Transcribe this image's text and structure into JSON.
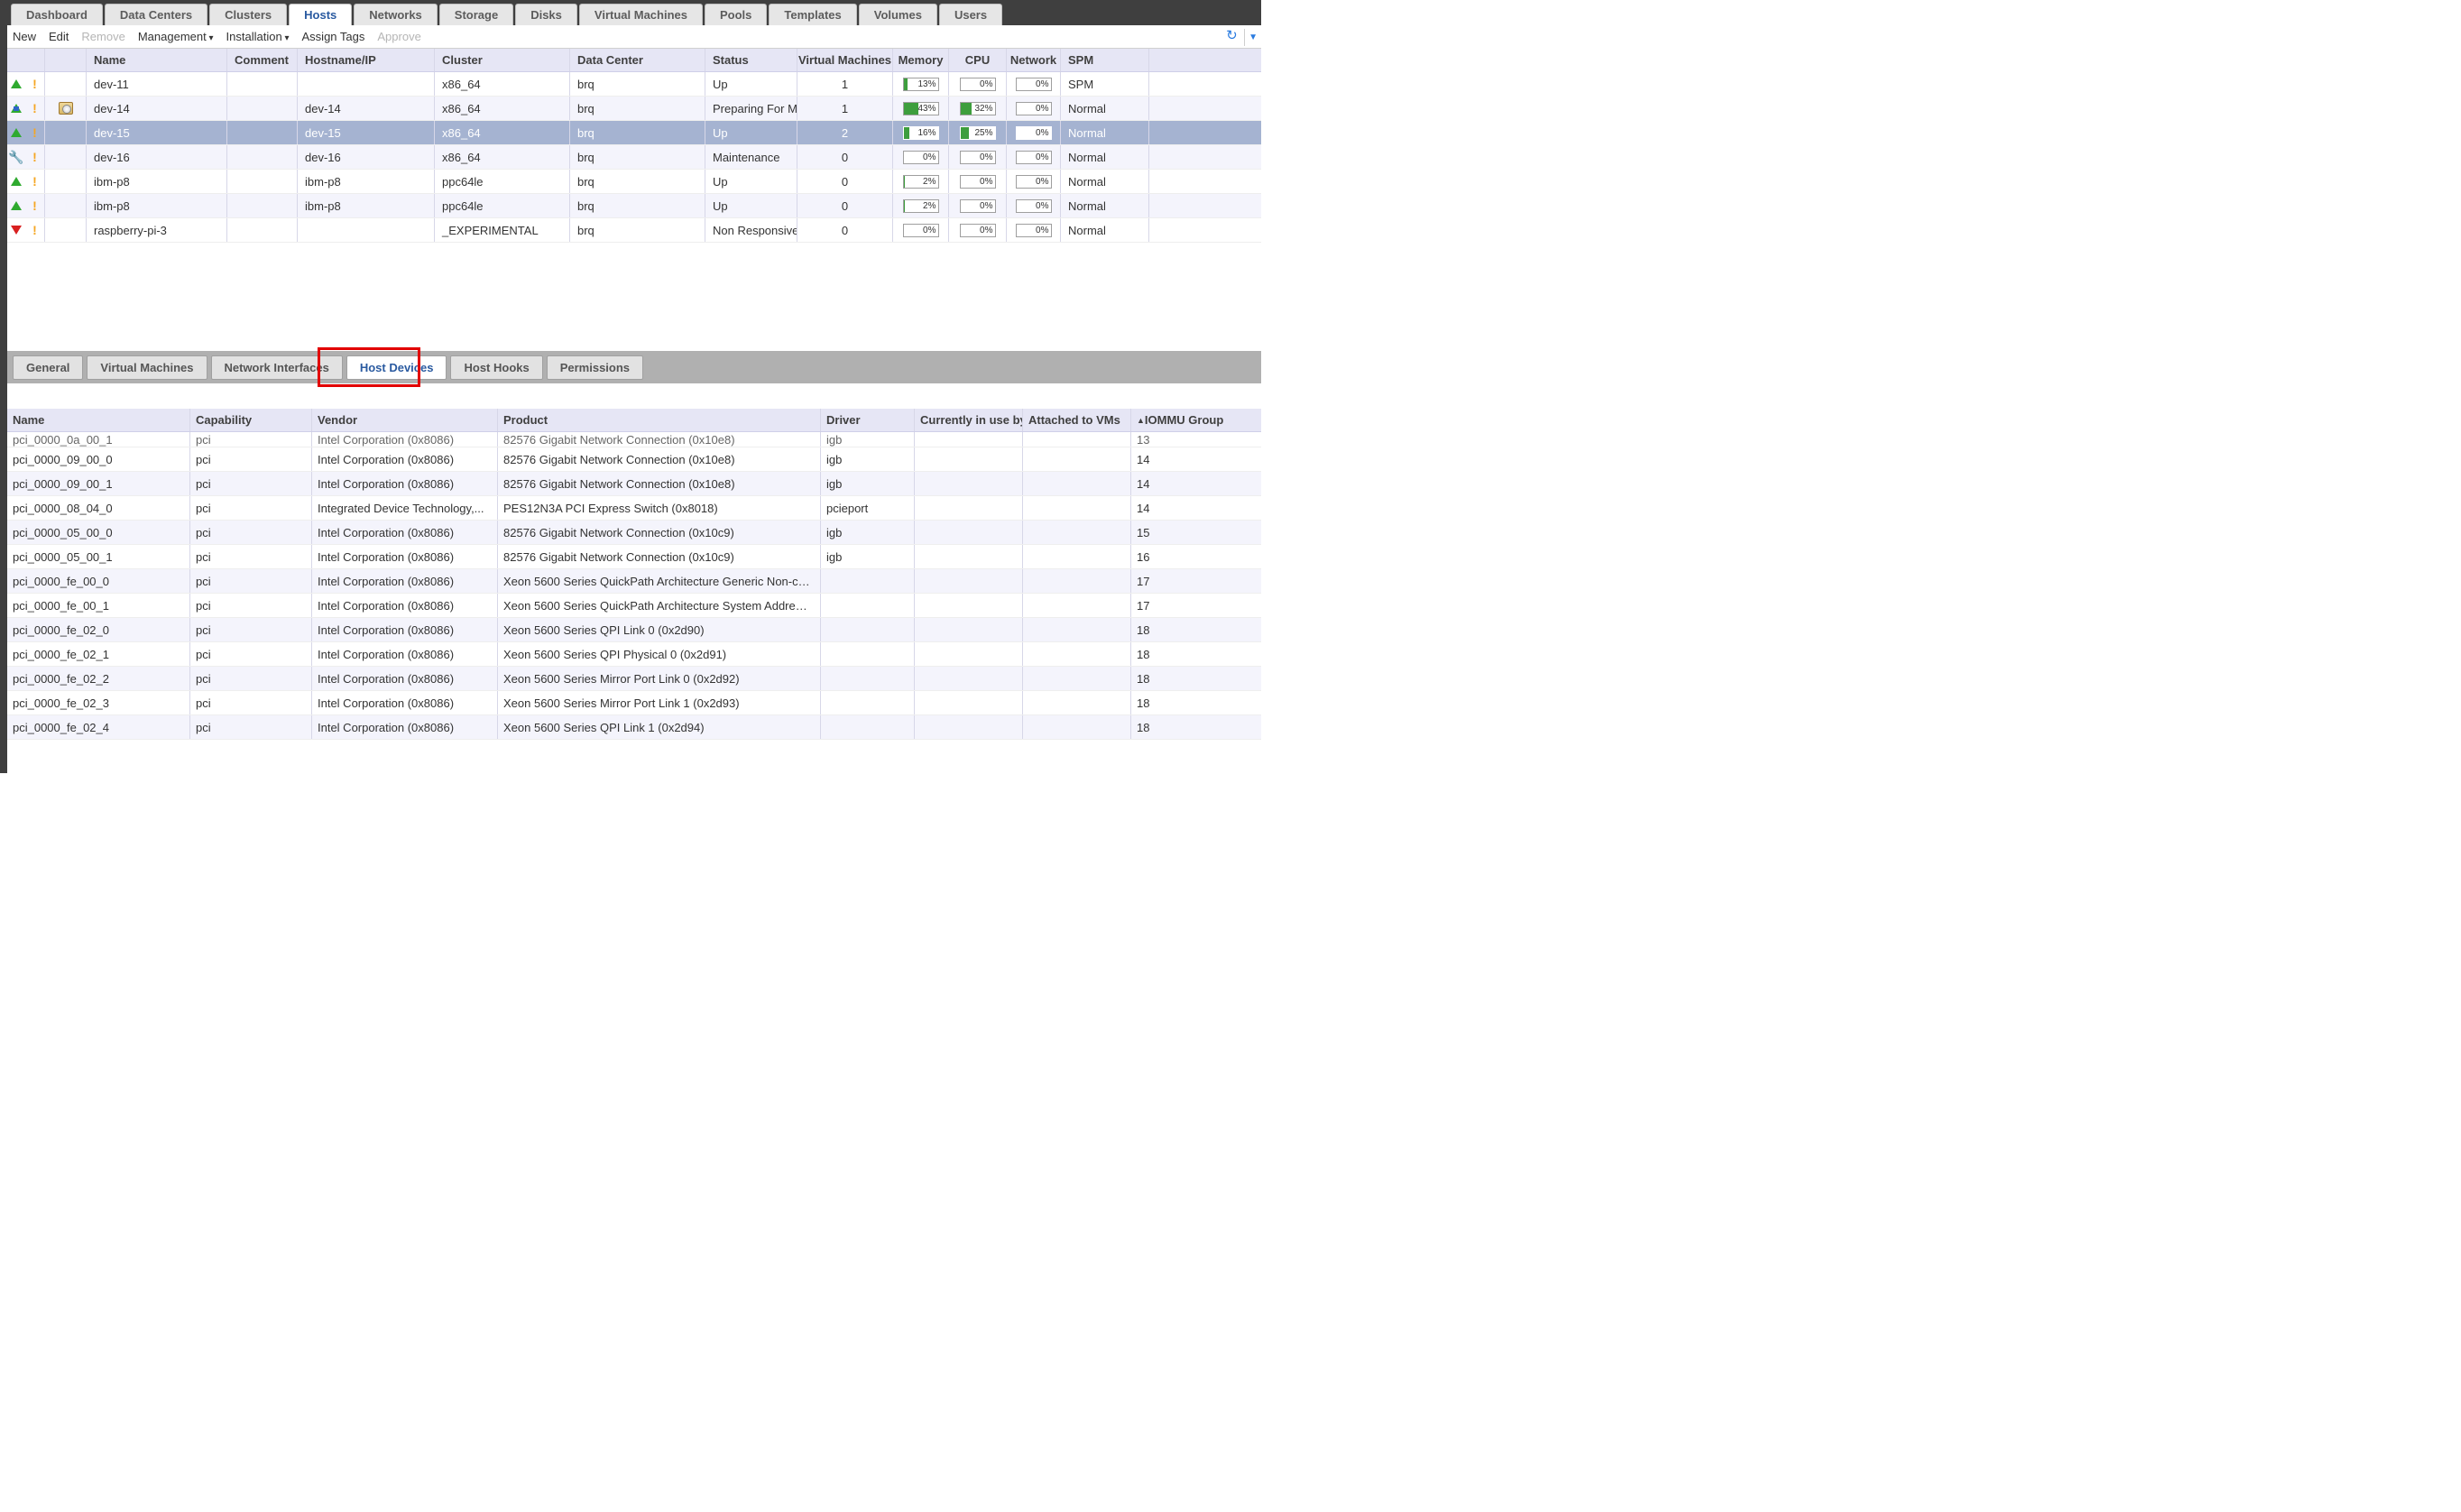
{
  "topTabs": [
    "Dashboard",
    "Data Centers",
    "Clusters",
    "Hosts",
    "Networks",
    "Storage",
    "Disks",
    "Virtual Machines",
    "Pools",
    "Templates",
    "Volumes",
    "Users"
  ],
  "topActive": 3,
  "toolbar": {
    "new": "New",
    "edit": "Edit",
    "remove": "Remove",
    "management": "Management",
    "installation": "Installation",
    "assign": "Assign Tags",
    "approve": "Approve"
  },
  "hostCols": {
    "name": "Name",
    "comment": "Comment",
    "host": "Hostname/IP",
    "cluster": "Cluster",
    "dc": "Data Center",
    "status": "Status",
    "vms": "Virtual Machines",
    "mem": "Memory",
    "cpu": "CPU",
    "net": "Network",
    "spm": "SPM"
  },
  "hosts": [
    {
      "s1": "up",
      "s2": "warn",
      "icon": "",
      "name": "dev-11",
      "host": "",
      "cluster": "x86_64",
      "dc": "brq",
      "status": "Up",
      "vms": "1",
      "mem": 13,
      "cpu": 0,
      "net": 0,
      "spm": "SPM",
      "sel": false
    },
    {
      "s1": "maint",
      "s2": "warn",
      "icon": "cd",
      "name": "dev-14",
      "host": "dev-14",
      "cluster": "x86_64",
      "dc": "brq",
      "status": "Preparing For Ma",
      "vms": "1",
      "mem": 43,
      "cpu": 32,
      "net": 0,
      "spm": "Normal",
      "sel": false
    },
    {
      "s1": "up",
      "s2": "warn",
      "icon": "",
      "name": "dev-15",
      "host": "dev-15",
      "cluster": "x86_64",
      "dc": "brq",
      "status": "Up",
      "vms": "2",
      "mem": 16,
      "cpu": 25,
      "net": 0,
      "spm": "Normal",
      "sel": true
    },
    {
      "s1": "wrench",
      "s2": "warn",
      "icon": "",
      "name": "dev-16",
      "host": "dev-16",
      "cluster": "x86_64",
      "dc": "brq",
      "status": "Maintenance",
      "vms": "0",
      "mem": 0,
      "cpu": 0,
      "net": 0,
      "spm": "Normal",
      "sel": false
    },
    {
      "s1": "up",
      "s2": "warn",
      "icon": "",
      "name": "ibm-p8",
      "host": "ibm-p8",
      "cluster": "ppc64le",
      "dc": "brq",
      "status": "Up",
      "vms": "0",
      "mem": 2,
      "cpu": 0,
      "net": 0,
      "spm": "Normal",
      "sel": false
    },
    {
      "s1": "up",
      "s2": "warn",
      "icon": "",
      "name": "ibm-p8",
      "host": "ibm-p8",
      "cluster": "ppc64le",
      "dc": "brq",
      "status": "Up",
      "vms": "0",
      "mem": 2,
      "cpu": 0,
      "net": 0,
      "spm": "Normal",
      "sel": false
    },
    {
      "s1": "down",
      "s2": "warn",
      "icon": "",
      "name": "raspberry-pi-3",
      "host": "",
      "cluster": "_EXPERIMENTAL",
      "dc": "brq",
      "status": "Non Responsive",
      "vms": "0",
      "mem": 0,
      "cpu": 0,
      "net": 0,
      "spm": "Normal",
      "sel": false
    }
  ],
  "subTabs": [
    "General",
    "Virtual Machines",
    "Network Interfaces",
    "Host Devices",
    "Host Hooks",
    "Permissions"
  ],
  "subActive": 3,
  "devCols": {
    "name": "Name",
    "cap": "Capability",
    "ven": "Vendor",
    "prod": "Product",
    "drv": "Driver",
    "cur": "Currently in use by",
    "att": "Attached to VMs",
    "iom": "IOMMU Group"
  },
  "devCut": {
    "name": "pci_0000_0a_00_1",
    "cap": "pci",
    "ven": "Intel Corporation (0x8086)",
    "prod": "82576 Gigabit Network Connection (0x10e8)",
    "drv": "igb",
    "cur": "",
    "att": "",
    "iom": "13"
  },
  "devices": [
    {
      "name": "pci_0000_09_00_0",
      "cap": "pci",
      "ven": "Intel Corporation (0x8086)",
      "prod": "82576 Gigabit Network Connection (0x10e8)",
      "drv": "igb",
      "cur": "",
      "att": "",
      "iom": "14"
    },
    {
      "name": "pci_0000_09_00_1",
      "cap": "pci",
      "ven": "Intel Corporation (0x8086)",
      "prod": "82576 Gigabit Network Connection (0x10e8)",
      "drv": "igb",
      "cur": "",
      "att": "",
      "iom": "14"
    },
    {
      "name": "pci_0000_08_04_0",
      "cap": "pci",
      "ven": "Integrated Device Technology,...",
      "prod": "PES12N3A PCI Express Switch (0x8018)",
      "drv": "pcieport",
      "cur": "",
      "att": "",
      "iom": "14"
    },
    {
      "name": "pci_0000_05_00_0",
      "cap": "pci",
      "ven": "Intel Corporation (0x8086)",
      "prod": "82576 Gigabit Network Connection (0x10c9)",
      "drv": "igb",
      "cur": "",
      "att": "",
      "iom": "15"
    },
    {
      "name": "pci_0000_05_00_1",
      "cap": "pci",
      "ven": "Intel Corporation (0x8086)",
      "prod": "82576 Gigabit Network Connection (0x10c9)",
      "drv": "igb",
      "cur": "",
      "att": "",
      "iom": "16"
    },
    {
      "name": "pci_0000_fe_00_0",
      "cap": "pci",
      "ven": "Intel Corporation (0x8086)",
      "prod": "Xeon 5600 Series QuickPath Architecture Generic Non-c…",
      "drv": "",
      "cur": "",
      "att": "",
      "iom": "17"
    },
    {
      "name": "pci_0000_fe_00_1",
      "cap": "pci",
      "ven": "Intel Corporation (0x8086)",
      "prod": "Xeon 5600 Series QuickPath Architecture System Addre…",
      "drv": "",
      "cur": "",
      "att": "",
      "iom": "17"
    },
    {
      "name": "pci_0000_fe_02_0",
      "cap": "pci",
      "ven": "Intel Corporation (0x8086)",
      "prod": "Xeon 5600 Series QPI Link 0 (0x2d90)",
      "drv": "",
      "cur": "",
      "att": "",
      "iom": "18"
    },
    {
      "name": "pci_0000_fe_02_1",
      "cap": "pci",
      "ven": "Intel Corporation (0x8086)",
      "prod": "Xeon 5600 Series QPI Physical 0 (0x2d91)",
      "drv": "",
      "cur": "",
      "att": "",
      "iom": "18"
    },
    {
      "name": "pci_0000_fe_02_2",
      "cap": "pci",
      "ven": "Intel Corporation (0x8086)",
      "prod": "Xeon 5600 Series Mirror Port Link 0 (0x2d92)",
      "drv": "",
      "cur": "",
      "att": "",
      "iom": "18"
    },
    {
      "name": "pci_0000_fe_02_3",
      "cap": "pci",
      "ven": "Intel Corporation (0x8086)",
      "prod": "Xeon 5600 Series Mirror Port Link 1 (0x2d93)",
      "drv": "",
      "cur": "",
      "att": "",
      "iom": "18"
    },
    {
      "name": "pci_0000_fe_02_4",
      "cap": "pci",
      "ven": "Intel Corporation (0x8086)",
      "prod": "Xeon 5600 Series QPI Link 1 (0x2d94)",
      "drv": "",
      "cur": "",
      "att": "",
      "iom": "18"
    }
  ]
}
